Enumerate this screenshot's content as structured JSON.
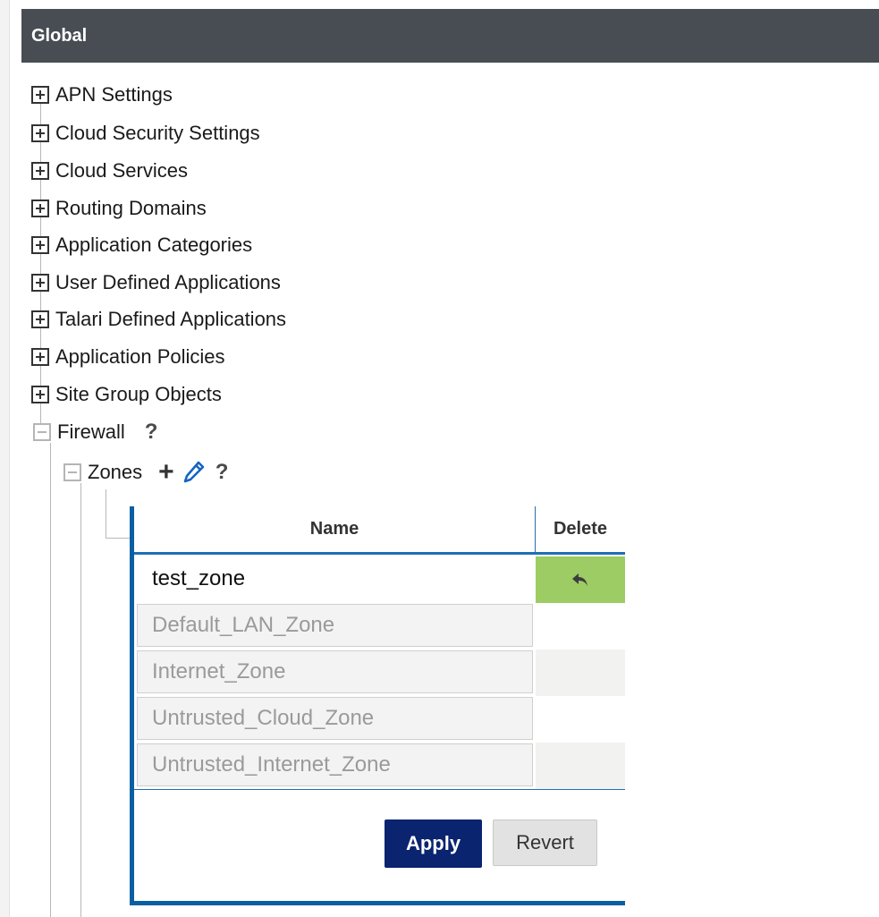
{
  "header": {
    "title": "Global"
  },
  "tree": {
    "items": [
      {
        "label": "APN Settings"
      },
      {
        "label": "Cloud Security Settings"
      },
      {
        "label": "Cloud Services"
      },
      {
        "label": "Routing Domains"
      },
      {
        "label": "Application Categories"
      },
      {
        "label": "User Defined Applications"
      },
      {
        "label": "Talari Defined Applications"
      },
      {
        "label": "Application Policies"
      },
      {
        "label": "Site Group Objects"
      }
    ],
    "firewall": {
      "label": "Firewall",
      "help": "?"
    },
    "zones": {
      "label": "Zones",
      "add": "+",
      "help": "?"
    }
  },
  "zones_table": {
    "columns": {
      "name": "Name",
      "delete": "Delete"
    },
    "rows": [
      {
        "name": "test_zone"
      },
      {
        "name": "Default_LAN_Zone"
      },
      {
        "name": "Internet_Zone"
      },
      {
        "name": "Untrusted_Cloud_Zone"
      },
      {
        "name": "Untrusted_Internet_Zone"
      }
    ],
    "apply_label": "Apply",
    "revert_label": "Revert"
  },
  "colors": {
    "header_bg": "#484d54",
    "panel_border": "#0a5fa3",
    "apply_bg": "#0b2470",
    "delete_undo_bg": "#9ccc63"
  },
  "icons": {
    "expand": "plus-box-icon",
    "collapse": "minus-box-icon",
    "edit": "pencil-icon",
    "undo": "undo-arrow-icon"
  }
}
